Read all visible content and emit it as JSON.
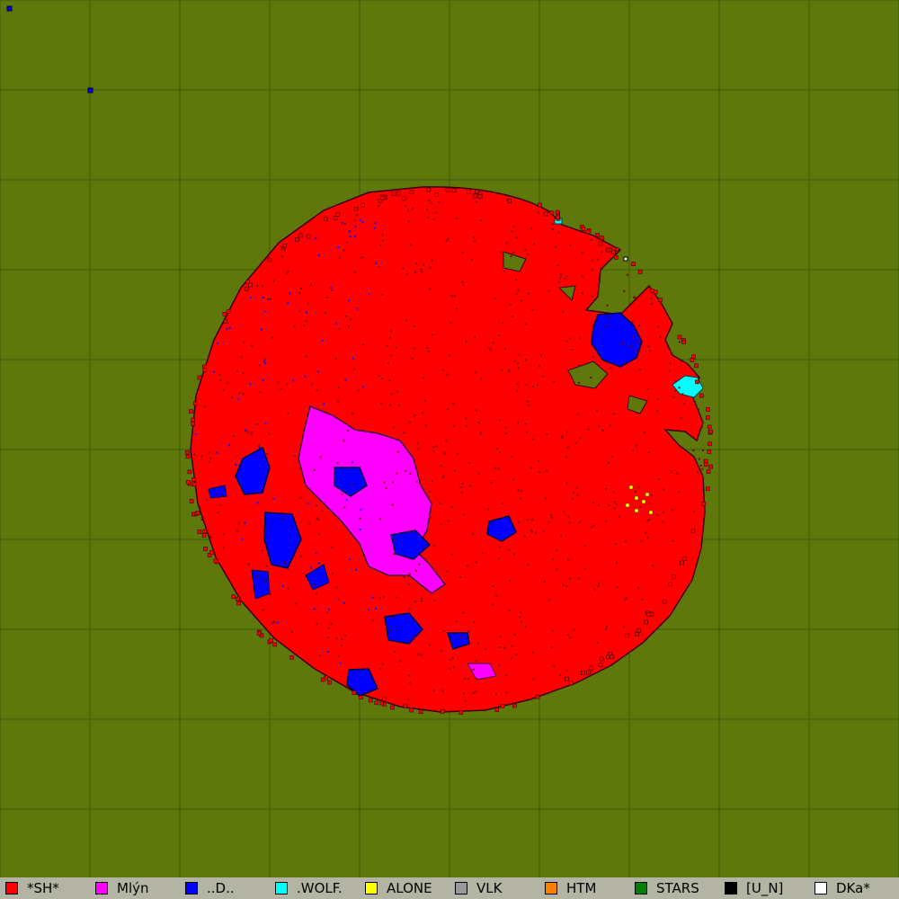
{
  "colors": {
    "background": "#5f780b",
    "grid_line": "#3d5a08",
    "legend_bg": "#b4b4a4",
    "outline": "#3a0000"
  },
  "legend": [
    {
      "label": "*SH*",
      "color": "#ff0000"
    },
    {
      "label": "Mlýn",
      "color": "#ff00ff"
    },
    {
      "label": "..D..",
      "color": "#0000ff"
    },
    {
      "label": ".WOLF.",
      "color": "#00ffff"
    },
    {
      "label": "ALONE",
      "color": "#ffff00"
    },
    {
      "label": "VLK",
      "color": "#999999"
    },
    {
      "label": "HTM",
      "color": "#ff8000"
    },
    {
      "label": "STARS",
      "color": "#008000"
    },
    {
      "label": "[U_N]",
      "color": "#000000"
    },
    {
      "label": "DKa*",
      "color": "#ffffff"
    }
  ]
}
